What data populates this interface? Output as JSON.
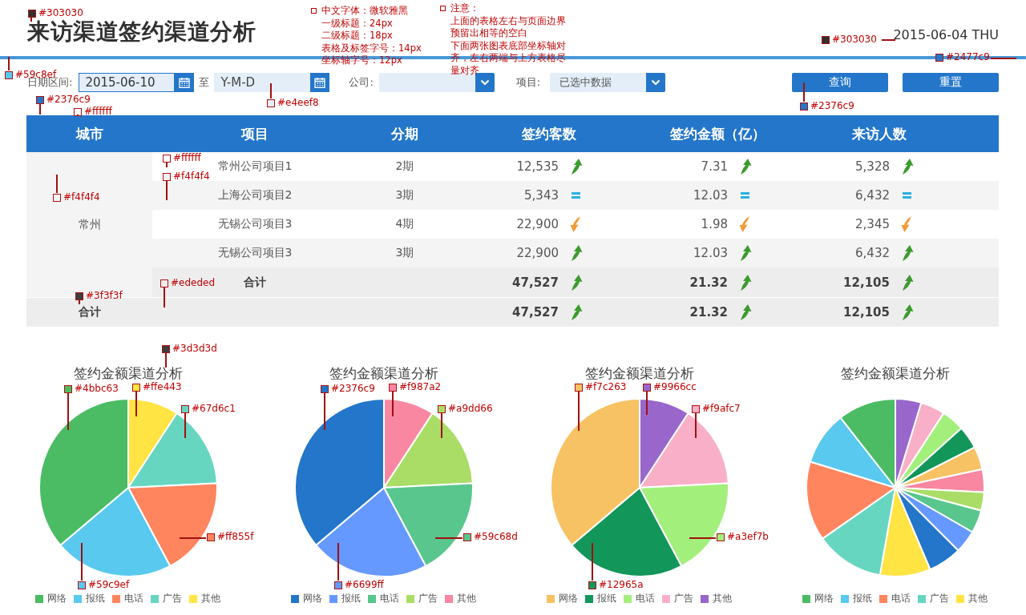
{
  "header": {
    "title": "来访渠道签约渠道分析",
    "date": "2015-06-04 THU"
  },
  "filters": {
    "date_label": "日期区间:",
    "date_from": {
      "value": "2015-06-10",
      "focused": true
    },
    "date_separator": "至",
    "date_to": {
      "placeholder": "Y-M-D",
      "focused": false
    },
    "company_label": "公司:",
    "project_label": "项目:",
    "project_select": {
      "value": "已选中数据"
    },
    "buttons": [
      "查询",
      "重置"
    ]
  },
  "table": {
    "columns": [
      "城市",
      "项目",
      "分期",
      "签约客数",
      "签约金额（亿）",
      "来访人数"
    ],
    "groups": [
      {
        "city": "常州",
        "rows": [
          {
            "project": "常州公司项目1",
            "phase": "2期",
            "metrics": [
              {
                "value": "12,535",
                "kind": "up"
              },
              {
                "value": "7.31",
                "kind": "up"
              },
              {
                "value": "5,328",
                "kind": "up"
              }
            ]
          },
          {
            "project": "上海公司项目2",
            "phase": "3期",
            "metrics": [
              {
                "value": "5,343",
                "kind": "same"
              },
              {
                "value": "12.03",
                "kind": "same"
              },
              {
                "value": "6,432",
                "kind": "same"
              }
            ]
          },
          {
            "project": "无锡公司项目3",
            "phase": "4期",
            "metrics": [
              {
                "value": "22,900",
                "kind": "down"
              },
              {
                "value": "1.98",
                "kind": "down"
              },
              {
                "value": "2,345",
                "kind": "down"
              }
            ]
          },
          {
            "project": "无锡公司项目3",
            "phase": "3期",
            "metrics": [
              {
                "value": "22,900",
                "kind": "up"
              },
              {
                "value": "12.03",
                "kind": "up"
              },
              {
                "value": "6,432",
                "kind": "up"
              }
            ]
          }
        ],
        "subtotal": {
          "label": "合计",
          "metrics": [
            {
              "value": "47,527",
              "kind": "up"
            },
            {
              "value": "21.32",
              "kind": "up"
            },
            {
              "value": "12,105",
              "kind": "up"
            }
          ]
        }
      }
    ],
    "total": {
      "label": "合计",
      "metrics": [
        {
          "value": "47,527",
          "kind": "up"
        },
        {
          "value": "21.32",
          "kind": "up"
        },
        {
          "value": "12,105",
          "kind": "up"
        }
      ]
    }
  },
  "charts": [
    {
      "kind": "simple",
      "title": "签约金额渠道分析",
      "legend": [
        {
          "label": "网络",
          "color": "#4bbc63"
        },
        {
          "label": "报纸",
          "color": "#59c9ef"
        },
        {
          "label": "电话",
          "color": "#ff855f"
        },
        {
          "label": "广告",
          "color": "#67d6c1"
        },
        {
          "label": "其他",
          "color": "#ffe443"
        }
      ]
    },
    {
      "kind": "simple",
      "title": "签约金额渠道分析",
      "legend": [
        {
          "label": "网络",
          "color": "#2376c9"
        },
        {
          "label": "报纸",
          "color": "#6699ff"
        },
        {
          "label": "电话",
          "color": "#59c68d"
        },
        {
          "label": "广告",
          "color": "#a9dd66"
        },
        {
          "label": "其他",
          "color": "#f987a2"
        }
      ]
    },
    {
      "kind": "simple",
      "title": "签约金额渠道分析",
      "legend": [
        {
          "label": "网络",
          "color": "#f7c263"
        },
        {
          "label": "报纸",
          "color": "#12965a"
        },
        {
          "label": "电话",
          "color": "#a3ef7b"
        },
        {
          "label": "广告",
          "color": "#f9afc7"
        },
        {
          "label": "其他",
          "color": "#9966cc"
        }
      ]
    },
    {
      "kind": "detailed",
      "title": "签约金额渠道分析",
      "legend": [
        {
          "label": "网络",
          "color": "#4bbc63"
        },
        {
          "label": "报纸",
          "color": "#59c9ef"
        },
        {
          "label": "电话",
          "color": "#ff855f"
        },
        {
          "label": "广告",
          "color": "#67d6c1"
        },
        {
          "label": "其他",
          "color": "#ffe443"
        }
      ]
    }
  ],
  "annotations": [
    {
      "kind": "swatch",
      "text": "#303030",
      "color": "#303030"
    },
    {
      "kind": "note",
      "lines": [
        "中文字体：微软雅黑",
        "一级标题：24px",
        "二级标题：18px",
        "表格及标签字号：14px",
        "坐标轴字号：12px"
      ]
    },
    {
      "kind": "note",
      "lines": [
        "注意：",
        "上面的表格左右与页面边界",
        "预留出相等的空白",
        "下面两张图表底部坐标轴对",
        "齐，左右两端与上方表格尽",
        "量对齐"
      ]
    },
    {
      "kind": "swatch",
      "text": "#303030",
      "color": "#303030"
    },
    {
      "kind": "swatch",
      "text": "#59c8ef",
      "color": "#59c8ef"
    },
    {
      "kind": "swatch",
      "text": "#2477c9",
      "color": "#2477c9"
    },
    {
      "kind": "swatch",
      "text": "#2376c9",
      "color": "#2376c9"
    },
    {
      "kind": "swatch",
      "text": "#ffffff",
      "color": "#ffffff"
    },
    {
      "kind": "swatch",
      "text": "#e4eef8",
      "color": "#e4eef8"
    },
    {
      "kind": "swatch",
      "text": "#2376c9",
      "color": "#2376c9"
    },
    {
      "kind": "swatch",
      "text": "#ffffff",
      "color": "#ffffff"
    },
    {
      "kind": "swatch",
      "text": "#f4f4f4",
      "color": "#f4f4f4"
    },
    {
      "kind": "swatch",
      "text": "#f4f4f4",
      "color": "#f4f4f4"
    },
    {
      "kind": "swatch",
      "text": "#ededed",
      "color": "#ededed"
    },
    {
      "kind": "swatch",
      "text": "#3f3f3f",
      "color": "#3f3f3f"
    },
    {
      "kind": "swatch",
      "text": "#3d3d3d",
      "color": "#3d3d3d"
    },
    {
      "kind": "swatch",
      "text": "#4bbc63",
      "color": "#4bbc63"
    },
    {
      "kind": "swatch",
      "text": "#ffe443",
      "color": "#ffe443"
    },
    {
      "kind": "swatch",
      "text": "#67d6c1",
      "color": "#67d6c1"
    },
    {
      "kind": "swatch",
      "text": "#ff855f",
      "color": "#ff855f"
    },
    {
      "kind": "swatch",
      "text": "#59c9ef",
      "color": "#59c9ef"
    },
    {
      "kind": "swatch",
      "text": "#2376c9",
      "color": "#2376c9"
    },
    {
      "kind": "swatch",
      "text": "#f987a2",
      "color": "#f987a2"
    },
    {
      "kind": "swatch",
      "text": "#a9dd66",
      "color": "#a9dd66"
    },
    {
      "kind": "swatch",
      "text": "#59c68d",
      "color": "#59c68d"
    },
    {
      "kind": "swatch",
      "text": "#6699ff",
      "color": "#6699ff"
    },
    {
      "kind": "swatch",
      "text": "#f7c263",
      "color": "#f7c263"
    },
    {
      "kind": "swatch",
      "text": "#9966cc",
      "color": "#9966cc"
    },
    {
      "kind": "swatch",
      "text": "#f9afc7",
      "color": "#f9afc7"
    },
    {
      "kind": "swatch",
      "text": "#a3ef7b",
      "color": "#a3ef7b"
    },
    {
      "kind": "swatch",
      "text": "#12965a",
      "color": "#12965a"
    }
  ]
}
